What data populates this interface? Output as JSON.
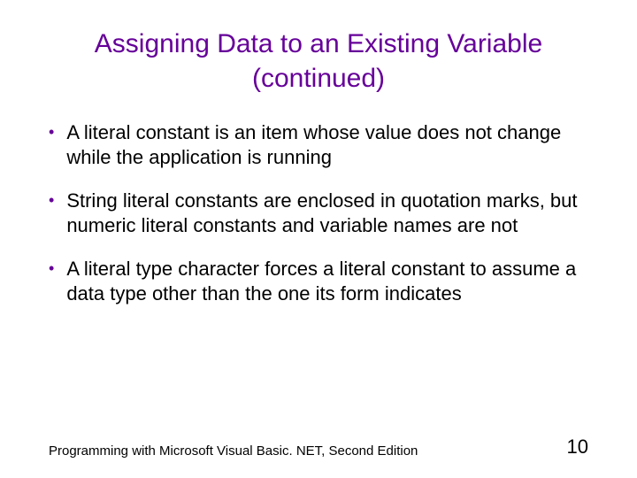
{
  "title": "Assigning Data to an Existing Variable (continued)",
  "bullets": [
    "A literal constant is an item whose value does not change while the application is running",
    "String literal constants are enclosed in quotation marks, but numeric literal constants and variable names are not",
    "A literal type character forces a literal constant to assume a data type other than the one its form indicates"
  ],
  "footer": "Programming with Microsoft Visual Basic. NET, Second Edition",
  "pageNumber": "10"
}
